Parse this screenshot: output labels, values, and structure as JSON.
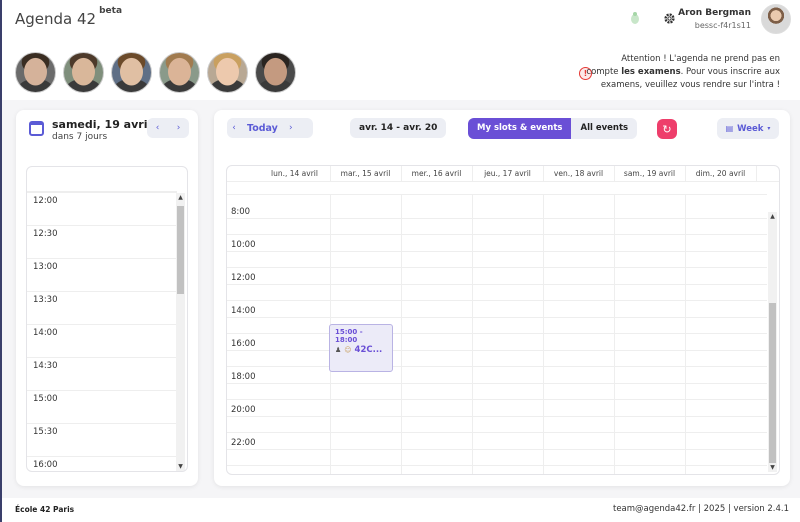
{
  "header": {
    "title": "Agenda 42",
    "badge": "beta",
    "user": {
      "name": "Aron Bergman",
      "login": "bessc-f4r1s11"
    },
    "settings_icon": "gear-icon",
    "extra_icon": "bug-icon"
  },
  "friends": [
    {
      "name": "friend-1",
      "skin": "#d5b29a",
      "bg": "#6b6b6b",
      "hair": "#3a2d22"
    },
    {
      "name": "friend-2",
      "skin": "#d9b79a",
      "bg": "#7f8f7c",
      "hair": "#4d3a2a"
    },
    {
      "name": "friend-3",
      "skin": "#e0bfa3",
      "bg": "#5f6f86",
      "hair": "#6b4a2a"
    },
    {
      "name": "friend-4",
      "skin": "#dbb497",
      "bg": "#8a9a8a",
      "hair": "#a17b4f"
    },
    {
      "name": "friend-5",
      "skin": "#edc9ad",
      "bg": "#b8a894",
      "hair": "#c9a060"
    },
    {
      "name": "friend-6",
      "skin": "#c49a80",
      "bg": "#4a4a4a",
      "hair": "#2a2420"
    }
  ],
  "warning": {
    "line1": "Attention ! L'agenda ne prend pas en",
    "line2a": "compte ",
    "line2b": "les examens",
    "line2c": ". Pour vous inscrire aux",
    "line3": "examens, veuillez vous rendre sur l'intra !"
  },
  "left_panel": {
    "date": "samedi, 19 avril",
    "relative": "dans 7 jours",
    "times": [
      "12:00",
      "12:30",
      "13:00",
      "13:30",
      "14:00",
      "14:30",
      "15:00",
      "15:30",
      "16:00"
    ]
  },
  "toolbar": {
    "today": "Today",
    "range": "avr. 14 - avr. 20",
    "my_slots": "My slots & events",
    "all_events": "All events",
    "view": "Week"
  },
  "calendar": {
    "days": [
      "lun., 14 avril",
      "mar., 15 avril",
      "mer., 16 avril",
      "jeu., 17 avril",
      "ven., 18 avril",
      "sam., 19 avril",
      "dim., 20 avril"
    ],
    "hours": [
      "8:00",
      "10:00",
      "12:00",
      "14:00",
      "16:00",
      "18:00",
      "20:00",
      "22:00"
    ],
    "event": {
      "time": "15:00 - 18:00",
      "title": "42C..."
    }
  },
  "footer": {
    "school": "École 42 Paris",
    "info": "team@agenda42.fr | 2025 | version 2.4.1"
  }
}
